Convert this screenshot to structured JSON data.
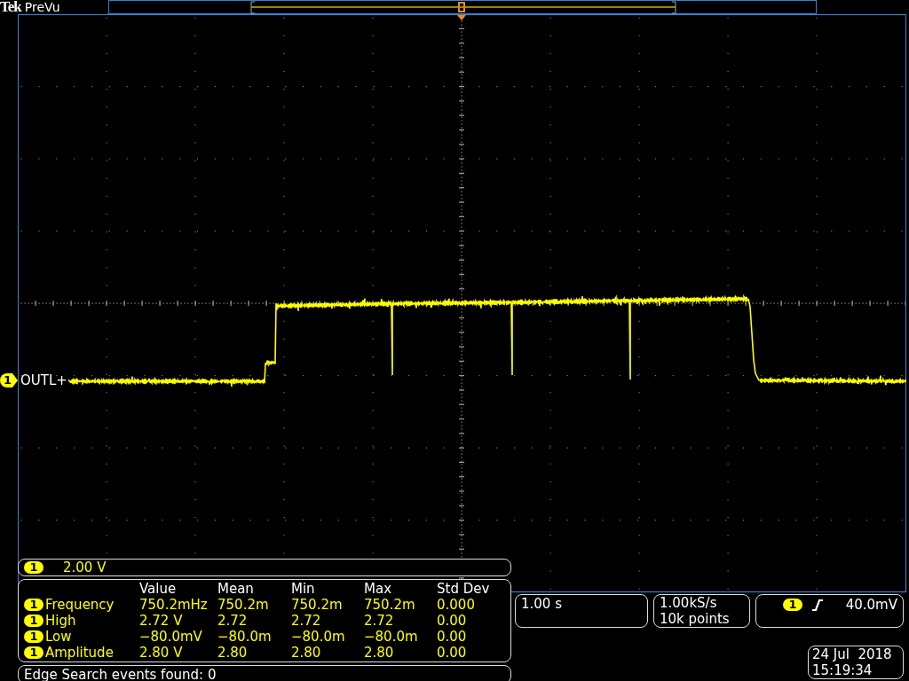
{
  "header": {
    "logo": "Tek",
    "mode": "PreVu"
  },
  "channel_marker": {
    "number": "1",
    "label": "OUTL+"
  },
  "vertical": {
    "channel": "1",
    "scale": "2.00 V"
  },
  "measurements": {
    "columns": [
      "Value",
      "Mean",
      "Min",
      "Max",
      "Std Dev"
    ],
    "rows": [
      {
        "channel": "1",
        "name": "Frequency",
        "cells": [
          "750.2mHz",
          "750.2m",
          "750.2m",
          "750.2m",
          "0.000"
        ]
      },
      {
        "channel": "1",
        "name": "High",
        "cells": [
          "2.72 V",
          "2.72",
          "2.72",
          "2.72",
          "0.00"
        ]
      },
      {
        "channel": "1",
        "name": "Low",
        "cells": [
          "−80.0mV",
          "−80.0m",
          "−80.0m",
          "−80.0m",
          "0.00"
        ]
      },
      {
        "channel": "1",
        "name": "Amplitude",
        "cells": [
          "2.80 V",
          "2.80",
          "2.80",
          "2.80",
          "0.00"
        ]
      }
    ]
  },
  "search": {
    "text": "Edge Search events found: 0"
  },
  "horizontal": {
    "scale": "1.00 s"
  },
  "acquisition": {
    "rate": "1.00kS/s",
    "points": "10k points"
  },
  "trigger": {
    "channel": "1",
    "level": "40.0mV"
  },
  "datetime": {
    "date": "24 Jul  2018",
    "time": "15:19:34"
  }
}
